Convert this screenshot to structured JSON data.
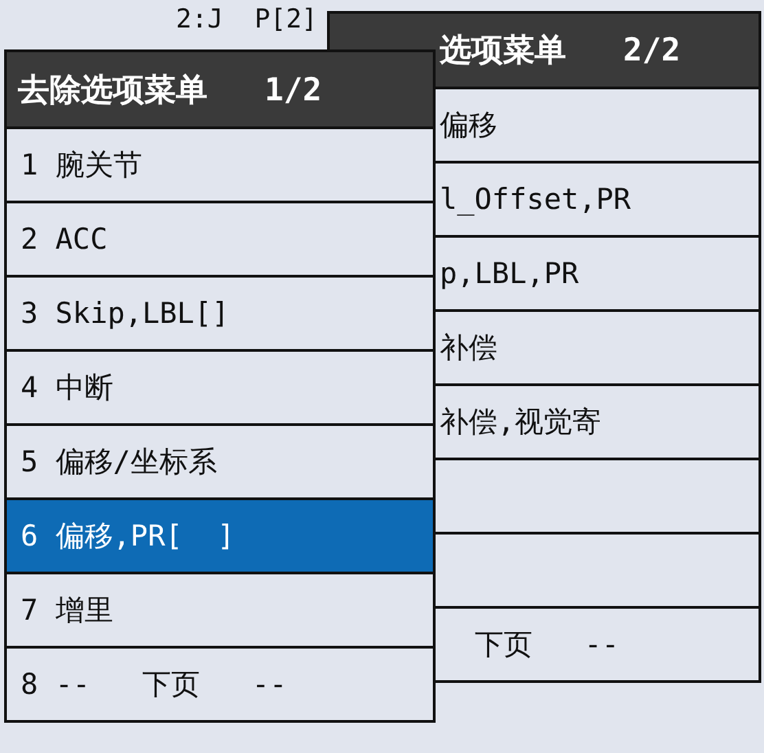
{
  "status_text": "2:J  P[2]",
  "back_menu": {
    "title": "选项菜单   2/2",
    "items": [
      {
        "label": "偏移",
        "selected": false
      },
      {
        "label": "l_Offset,PR",
        "selected": false
      },
      {
        "label": "p,LBL,PR",
        "selected": false
      },
      {
        "label": "补偿",
        "selected": false
      },
      {
        "label": "补偿,视觉寄",
        "selected": false
      },
      {
        "selected": false
      },
      {
        "selected": false
      },
      {
        "label": "  下页   --",
        "selected": false
      }
    ]
  },
  "front_menu": {
    "title": "去除选项菜单   1/2",
    "items": [
      {
        "label": "1 腕关节",
        "selected": false
      },
      {
        "label": "2 ACC",
        "selected": false
      },
      {
        "label": "3 Skip,LBL[]",
        "selected": false
      },
      {
        "label": "4 中断",
        "selected": false
      },
      {
        "label": "5 偏移/坐标系",
        "selected": false
      },
      {
        "label": "6 偏移,PR[  ]",
        "selected": true
      },
      {
        "label": "7 增里",
        "selected": false
      },
      {
        "label": "8 --   下页   --",
        "selected": false
      }
    ]
  }
}
